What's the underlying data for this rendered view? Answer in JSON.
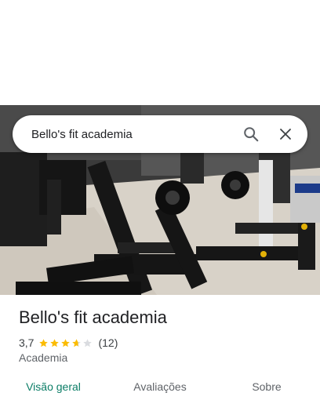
{
  "search": {
    "query": "Bello's fit academia"
  },
  "place": {
    "name": "Bello's fit academia",
    "rating": "3,7",
    "rating_value": 3.7,
    "reviews_count": "(12)",
    "category": "Academia"
  },
  "tabs": [
    {
      "label": "Visão geral",
      "active": true
    },
    {
      "label": "Avaliações",
      "active": false
    },
    {
      "label": "Sobre",
      "active": false
    }
  ],
  "colors": {
    "star": "#fbbc04",
    "star_empty": "#dadce0",
    "active_tab": "#0b7d66",
    "text": "#202124"
  }
}
